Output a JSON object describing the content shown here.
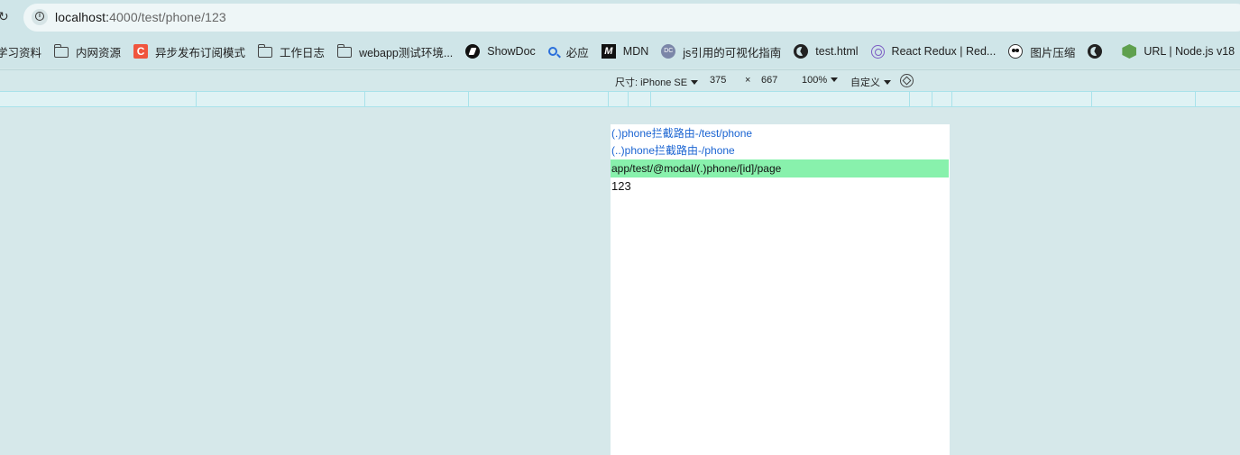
{
  "browser": {
    "url_host": "localhost:",
    "url_rest": "4000/test/phone/123"
  },
  "bookmarks": [
    {
      "label": "学习资料",
      "icon": "folder-icon"
    },
    {
      "label": "内网资源",
      "icon": "folder-icon"
    },
    {
      "label": "异步发布订阅模式",
      "icon": "csdn-icon"
    },
    {
      "label": "工作日志",
      "icon": "folder-icon"
    },
    {
      "label": "webapp测试环境...",
      "icon": "folder-icon"
    },
    {
      "label": "ShowDoc",
      "icon": "showdoc-icon"
    },
    {
      "label": "必应",
      "icon": "bing-search-icon"
    },
    {
      "label": "MDN",
      "icon": "mdn-icon"
    },
    {
      "label": "js引用的可视化指南",
      "icon": "dc-icon"
    },
    {
      "label": "test.html",
      "icon": "globe-icon"
    },
    {
      "label": "React Redux | Red...",
      "icon": "redux-icon"
    },
    {
      "label": "图片压缩",
      "icon": "panda-icon"
    },
    {
      "label": "",
      "icon": "globe-icon"
    },
    {
      "label": "URL | Node.js v18",
      "icon": "nodejs-icon"
    }
  ],
  "device_toolbar": {
    "dimensions_label": "尺寸: iPhone SE",
    "width": "375",
    "times": "×",
    "height": "667",
    "zoom": "100%",
    "throttle": "自定义"
  },
  "page": {
    "link1": "(.)phone拦截路由-/test/phone",
    "link2": "(..)phone拦截路由-/phone",
    "modal_path": "app/test/@modal/(.)phone/[id]/page",
    "id_value": "123"
  },
  "colors": {
    "link": "#1a64d2",
    "highlight": "#88f1ac",
    "chrome_bg": "#cfe5e8"
  }
}
